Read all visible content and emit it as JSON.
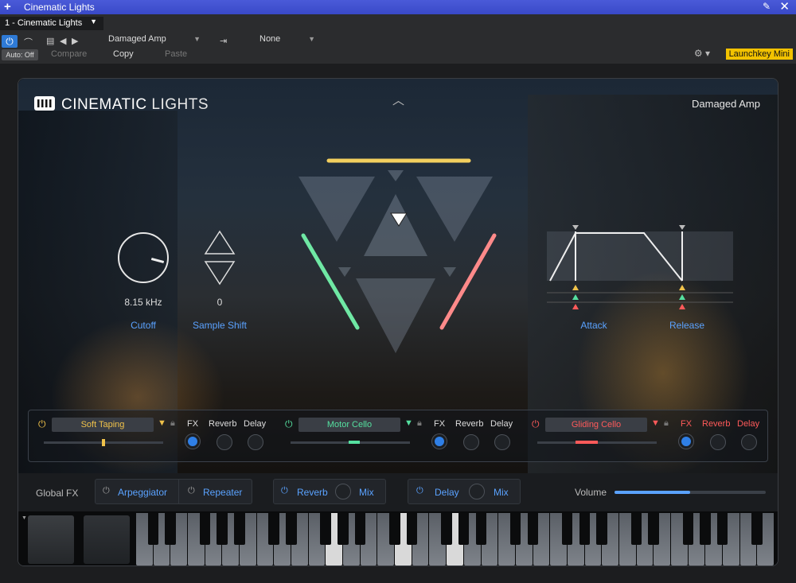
{
  "window": {
    "title": "Cinematic Lights"
  },
  "host": {
    "instrument_selector": "1 - Cinematic Lights",
    "preset_name": "Damaged Amp",
    "sidechain_value": "None",
    "auto_label": "Auto: Off",
    "compare_label": "Compare",
    "copy_label": "Copy",
    "paste_label": "Paste",
    "device_label": "Launchkey Mini"
  },
  "plugin": {
    "brand_bold": "CINEMATIC",
    "brand_light": "LIGHTS",
    "preset_display": "Damaged Amp",
    "cutoff": {
      "value": "8.15 kHz",
      "label": "Cutoff"
    },
    "sample_shift": {
      "value": "0",
      "label": "Sample Shift"
    },
    "attack_label": "Attack",
    "release_label": "Release",
    "slots": [
      {
        "name": "Soft Taping",
        "fx": "FX",
        "reverb": "Reverb",
        "delay": "Delay",
        "color": "#f0c24a",
        "level": 0.5
      },
      {
        "name": "Motor Cello",
        "fx": "FX",
        "reverb": "Reverb",
        "delay": "Delay",
        "color": "#55e0a0",
        "level": 0.5
      },
      {
        "name": "Gliding Cello",
        "fx": "FX",
        "reverb": "Reverb",
        "delay": "Delay",
        "color": "#ff5a5a",
        "level": 0.5
      }
    ],
    "global": {
      "label": "Global FX",
      "arpeggiator": "Arpeggiator",
      "repeater": "Repeater",
      "reverb": "Reverb",
      "reverb_mix": "Mix",
      "delay": "Delay",
      "delay_mix": "Mix",
      "volume_label": "Volume",
      "volume_level": 0.5
    }
  }
}
